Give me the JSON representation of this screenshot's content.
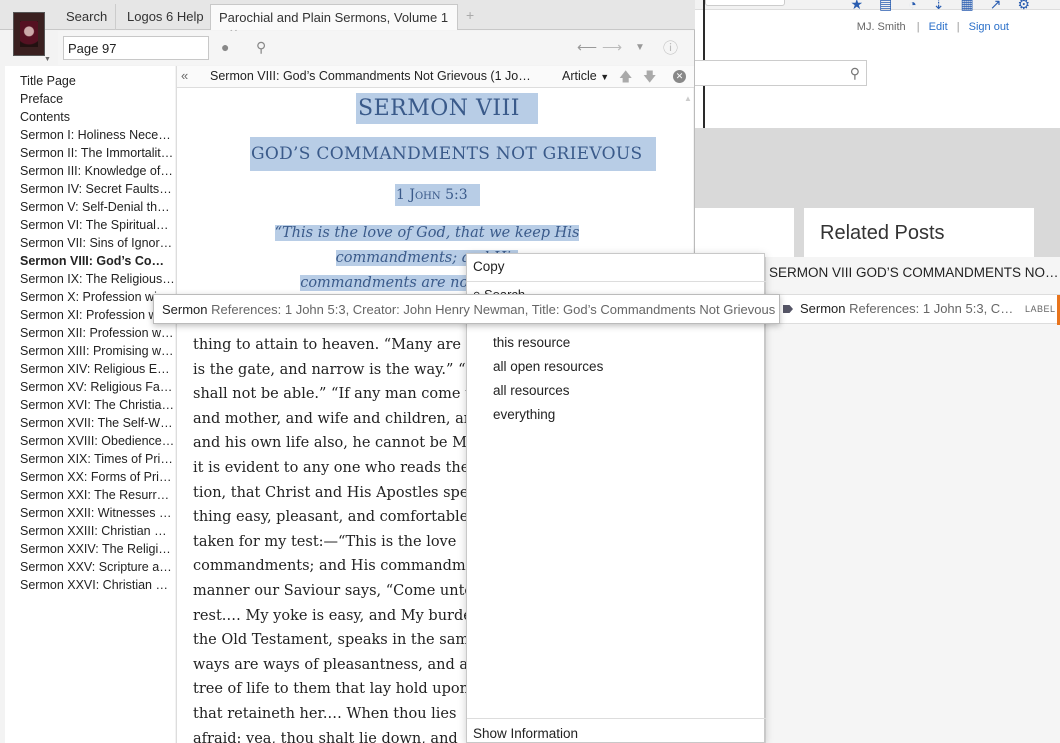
{
  "browser": {
    "user_name": "MJ. Smith",
    "edit_link": "Edit",
    "signout_link": "Sign out",
    "separator": "|",
    "related_heading": "Related Posts"
  },
  "tabs": [
    {
      "label": "Search"
    },
    {
      "label": "Logos 6 Help"
    },
    {
      "label": "Parochial and Plain Sermons, Volume 1"
    }
  ],
  "toolbar": {
    "page_value": "Page 97"
  },
  "toc": [
    "Title Page",
    "Preface",
    "Contents",
    "Sermon I: Holiness Neces…",
    "Sermon II: The Immortalit…",
    "Sermon III: Knowledge of…",
    "Sermon IV: Secret Faults (…",
    "Sermon V: Self-Denial the…",
    "Sermon VI: The Spiritual…",
    "Sermon VII: Sins of Ignora…",
    "Sermon VIII: God’s Com…",
    "Sermon IX: The Religious…",
    "Sermon X: Profession wi…",
    "Sermon XI: Profession w…",
    "Sermon XII: Profession wit…",
    "Sermon XIII: Promising wi…",
    "Sermon XIV: Religious Em…",
    "Sermon XV: Religious Fait…",
    "Sermon XVI: The Christian…",
    "Sermon XVII: The Self-Wis…",
    "Sermon XVIII: Obedience t…",
    "Sermon XIX: Times of Priv…",
    "Sermon XX: Forms of Priv…",
    "Sermon XXI: The Resurrec…",
    "Sermon XXII: Witnesses of…",
    "Sermon XXIII: Christian Re…",
    "Sermon XXIV: The Religio…",
    "Sermon XXV: Scripture a R…",
    "Sermon XXVI: Christian M…"
  ],
  "toc_current_index": 10,
  "reader": {
    "header_title": "Sermon VIII: God’s Commandments Not Grievous (1 John …",
    "article_label": "Article",
    "sermon_number": "SERMON VIII",
    "sermon_title": "GOD’S COMMANDMENTS NOT GRIEVOUS",
    "scripture_ref_number": "1",
    "scripture_ref_book": "John",
    "scripture_ref_verse": "5:3",
    "epigraph_line1": "“This is the love of God, that we keep His commandments; and His",
    "epigraph_line2": "commandments are not grievous.”",
    "body_lines": [
      "thing to attain to heaven. “Many are cal",
      "is the gate, and narrow is the way.” “Ma",
      "shall not be able.” “If any man come to",
      "and mother, and wife and children, an",
      "and his own life also, he cannot be My d",
      "it is evident to any one who reads the",
      "tion, that Christ and His Apostles speal",
      "thing easy, pleasant, and comfortable.",
      "taken for my test:—“This is the love",
      "commandments; and His commandmer",
      "manner our Saviour says, “Come unto",
      "rest.… My yoke is easy, and My burden",
      "the Old Testament, speaks in the same",
      "ways are ways of pleasantness, and all l",
      "tree of life to them that lay hold upon l",
      "that retaineth her.… When thou lies",
      "afraid: yea, thou shalt lie down, and"
    ]
  },
  "tooltip": {
    "kind": "Sermon",
    "details": "References: 1 John 5:3, Creator: John Henry Newman, Title: God’s Commandments Not Grievous"
  },
  "context_menu": {
    "copy": "Copy",
    "search": "Search",
    "options": [
      "this resource",
      "all open resources",
      "all resources",
      "everything"
    ],
    "show_information": "Show Information"
  },
  "context_right": {
    "heading": "SERMON VIII GOD’S COMMANDMENTS NOT GRIE…",
    "row_kind": "Sermon",
    "row_text": "References: 1 John 5:3, Cre…",
    "row_label": "LABEL",
    "accent_color": "#e8741c"
  },
  "colors": {
    "highlight": "#b8cde6",
    "heading_blue": "#3a5a8a",
    "link_blue": "#2a6fc9"
  }
}
